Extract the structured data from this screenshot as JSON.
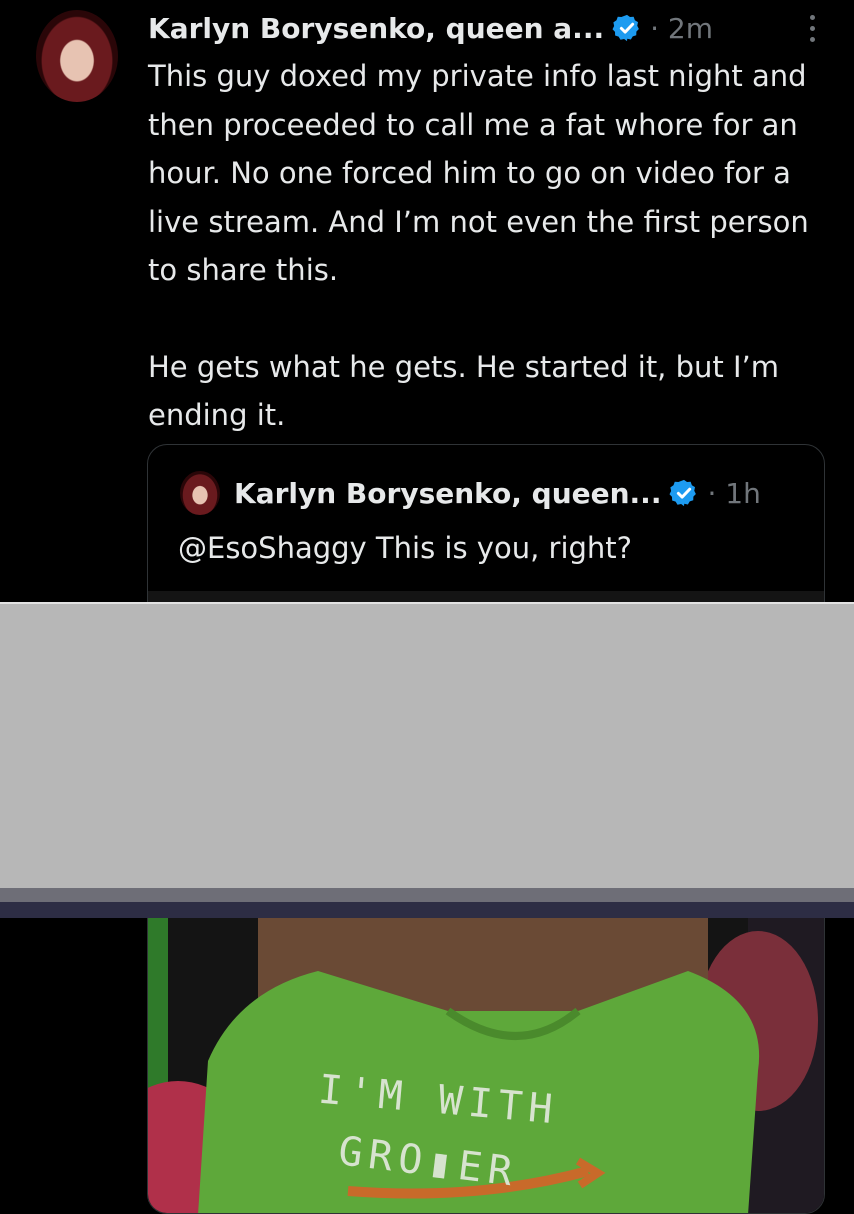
{
  "post": {
    "author": "Karlyn Borysenko, queen a...",
    "time": "· 2m",
    "paragraphs": [
      "This guy doxed my private info last night and then proceeded to call me a fat whore for an hour. No one forced him to go on video for a live stream. And I’m not even the first person to share this.",
      "He gets what he gets. He started it, but I’m ending it."
    ]
  },
  "quoted_post": {
    "author": "Karlyn Borysenko, queen...",
    "time": "· 1h",
    "text": "@EsoShaggy This is you, right?",
    "media_text": {
      "line1": "I'M WITH",
      "line2": "GRO▮ER"
    }
  },
  "icons": {
    "verified": "verified-badge-icon",
    "more": "more-vertical-icon"
  },
  "colors": {
    "background": "#000000",
    "text": "#e7e9ea",
    "muted": "#71767b",
    "verified": "#1d9bf0",
    "card_border": "#2f3336",
    "redaction": "#b7b7b7"
  }
}
